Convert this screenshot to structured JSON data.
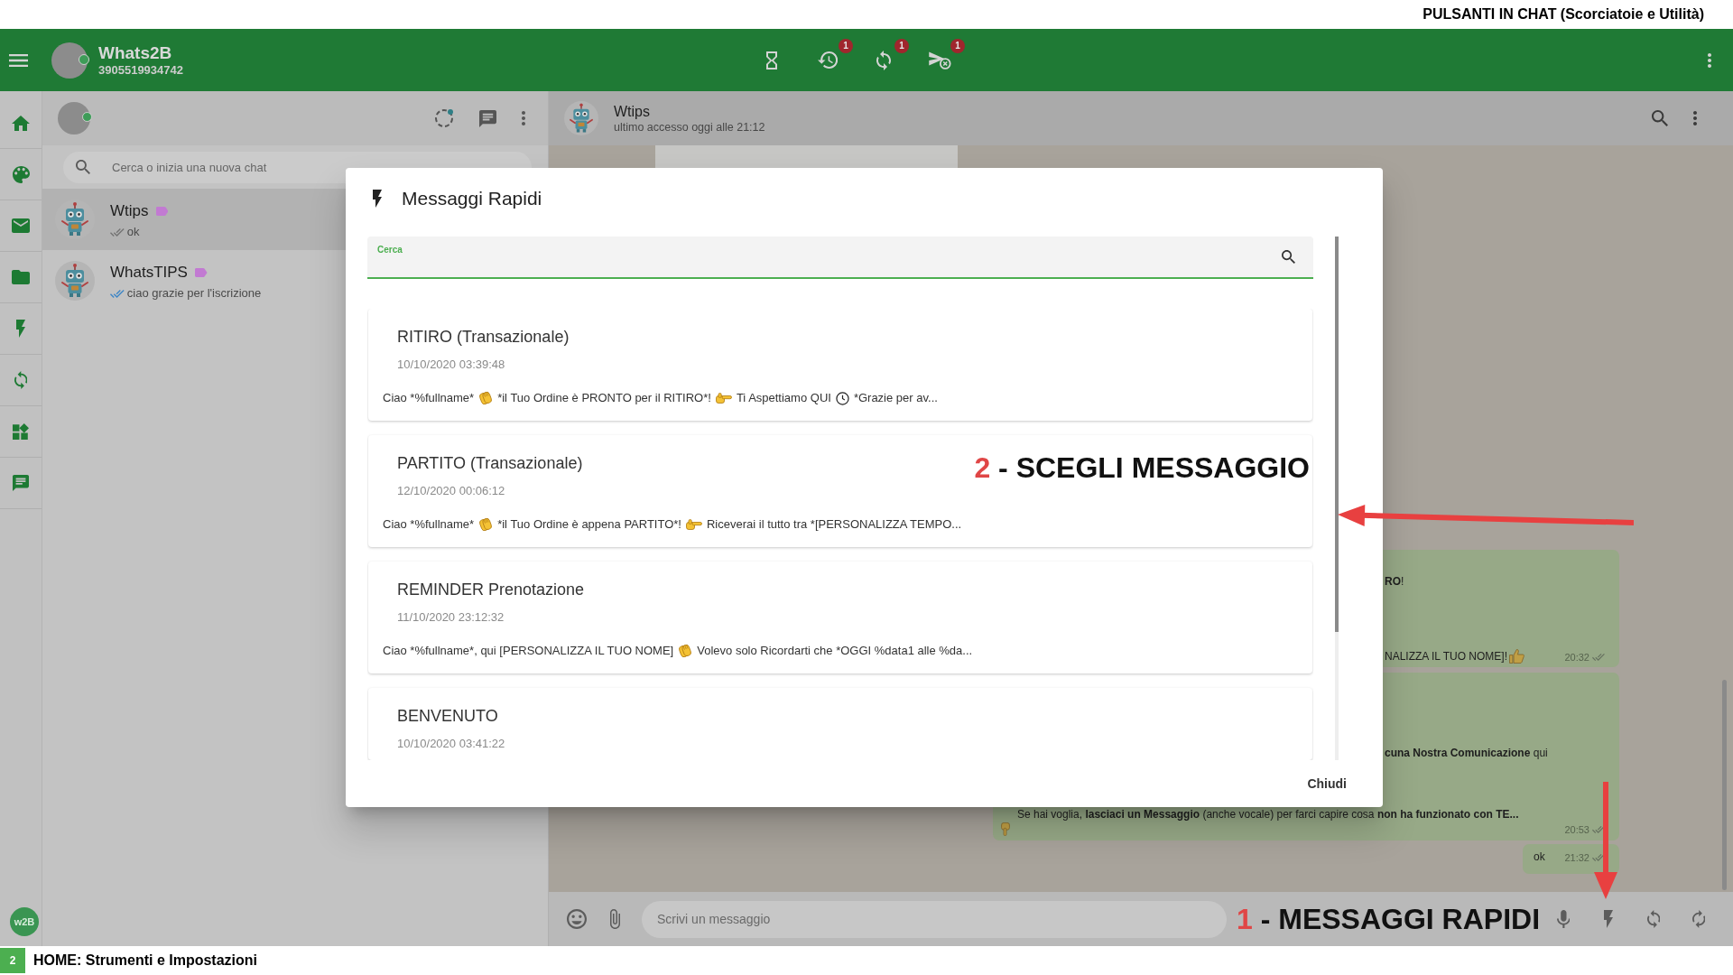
{
  "caption_top": "PULSANTI IN CHAT (Scorciatoie e Utilità)",
  "app_bar": {
    "title": "Whats2B",
    "subtitle": "3905519934742",
    "actions": [
      {
        "kind": "hourglass"
      },
      {
        "kind": "history",
        "badge": "1"
      },
      {
        "kind": "sync",
        "badge": "1"
      },
      {
        "kind": "send-cancel",
        "badge": "1"
      }
    ]
  },
  "rail": {
    "items": [
      {
        "kind": "home"
      },
      {
        "kind": "palette"
      },
      {
        "kind": "mail"
      },
      {
        "kind": "folder"
      },
      {
        "kind": "flash"
      },
      {
        "kind": "sync"
      },
      {
        "kind": "widgets"
      },
      {
        "kind": "chat"
      }
    ],
    "logo": "w2B"
  },
  "chat_list": {
    "actions": [
      {
        "kind": "status"
      },
      {
        "kind": "chat"
      },
      {
        "kind": "menu"
      }
    ],
    "search": {
      "placeholder": "Cerca o inizia una nuova chat"
    },
    "chats": [
      {
        "name": "Wtips",
        "preview": "ok",
        "selected": true,
        "read": false,
        "tag": {
          "color": "#c27ad2"
        }
      },
      {
        "name": "WhatsTIPS",
        "preview": "ciao grazie per l'iscrizione",
        "selected": false,
        "read": true,
        "tag": {
          "color": "#c27ad2"
        }
      }
    ]
  },
  "conversation": {
    "name": "Wtips",
    "status": "ultimo accesso oggi alle 21:12",
    "messages": [
      {
        "lines": [
          {
            "kind": "tail",
            "parts": [
              {
                "kind": "text",
                "text": "**RO**!"
              }
            ]
          },
          {
            "kind": "tail",
            "parts": [
              {
                "kind": "text",
                "text": "NALIZZA IL TUO NOME]!"
              },
              {
                "kind": "thumbs-up"
              }
            ]
          }
        ],
        "time": "20:32",
        "read": false
      },
      {
        "lines": [
          {
            "kind": "tail",
            "parts": [
              {
                "kind": "text",
                "text": "**cuna Nostra Comunicazione** qui"
              }
            ]
          },
          {
            "kind": "full",
            "parts": [
              {
                "kind": "text",
                "text": "Se hai voglia, **lasciaci un Messaggio** (anche vocale) per farci capire cosa **non ha funzionato con TE...**"
              }
            ]
          },
          {
            "kind": "full",
            "parts": [
              {
                "kind": "pointing-down"
              }
            ]
          }
        ],
        "time": "20:53",
        "read": false
      },
      {
        "lines": [
          {
            "kind": "full",
            "parts": [
              {
                "kind": "text",
                "text": "ok"
              }
            ]
          }
        ],
        "time": "21:32",
        "read": false
      }
    ],
    "composer": {
      "leading": [
        {
          "kind": "emoji"
        },
        {
          "kind": "attach"
        }
      ],
      "placeholder": "Scrivi un messaggio",
      "callout": {
        "number": "1",
        "text": "- MESSAGGI RAPIDI"
      },
      "actions": [
        {
          "kind": "mic"
        },
        {
          "kind": "flash"
        },
        {
          "kind": "sync"
        },
        {
          "kind": "autorenew"
        }
      ]
    }
  },
  "dialog": {
    "title": "Messaggi Rapidi",
    "search": {
      "label": "Cerca"
    },
    "items": [
      {
        "title": "RITIRO (Transazionale)",
        "date": "10/10/2020 03:39:48",
        "preview": [
          {
            "kind": "text",
            "text": "Ciao *%fullname*"
          },
          {
            "kind": "clap"
          },
          {
            "kind": "text",
            "text": "*il Tuo Ordine è PRONTO per il RITIRO*!"
          },
          {
            "kind": "pointer"
          },
          {
            "kind": "text",
            "text": "Ti Aspettiamo QUI"
          },
          {
            "kind": "clock"
          },
          {
            "kind": "text",
            "text": "*Grazie per av..."
          }
        ]
      },
      {
        "title": "PARTITO (Transazionale)",
        "callout": {
          "number": "2",
          "text": "- SCEGLI MESSAGGIO"
        },
        "date": "12/10/2020 00:06:12",
        "preview": [
          {
            "kind": "text",
            "text": "Ciao *%fullname*"
          },
          {
            "kind": "clap"
          },
          {
            "kind": "text",
            "text": "*il Tuo Ordine è appena PARTITO*!"
          },
          {
            "kind": "pointer"
          },
          {
            "kind": "text",
            "text": "Riceverai il tutto tra *[PERSONALIZZA TEMPO..."
          }
        ]
      },
      {
        "title": "REMINDER Prenotazione",
        "date": "11/10/2020 23:12:32",
        "preview": [
          {
            "kind": "text",
            "text": "Ciao *%fullname*, qui [PERSONALIZZA IL TUO NOME]"
          },
          {
            "kind": "clap"
          },
          {
            "kind": "text",
            "text": "Volevo solo Ricordarti che *OGGI %data1 alle %da..."
          }
        ]
      },
      {
        "title": "BENVENUTO",
        "date": "10/10/2020 03:41:22"
      }
    ],
    "close_button": "Chiudi"
  },
  "footer": {
    "step": "2",
    "caption": "HOME: Strumenti e Impostazioni"
  }
}
